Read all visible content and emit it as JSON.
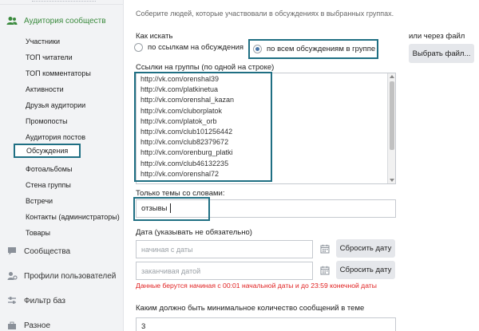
{
  "sidebar": {
    "active_section": "Аудитория сообществ",
    "items": [
      "Участники",
      "ТОП читатели",
      "ТОП комментаторы",
      "Активности",
      "Друзья аудитории",
      "Промопосты",
      "Аудитория постов",
      "Обсуждения",
      "Фотоальбомы",
      "Стена группы",
      "Встречи",
      "Контакты (администраторы)",
      "Товары"
    ],
    "selected_item": "Обсуждения",
    "sections": [
      "Сообщества",
      "Профили пользователей",
      "Фильтр баз",
      "Разное"
    ],
    "accent_color": "#3a8a3d",
    "highlight_color": "#1f6f83"
  },
  "main": {
    "hint": "Соберите людей, которые участвовали в обсуждениях в выбранных группах.",
    "how_label": "Как искать",
    "radio_option_1": "по ссылкам на обсуждения",
    "radio_option_2": "по всем обсуждениям в группе",
    "selected_radio": "по всем обсуждениям в группе",
    "file_label": "или через файл",
    "file_button": "Выбрать файл...",
    "links_label": "Ссылки на группы (по одной на строке)",
    "links": [
      "http://vk.com/orenshal39",
      "http://vk.com/platkinetua",
      "http://vk.com/orenshal_kazan",
      "http://vk.com/cluborplatok",
      "http://vk.com/platok_orb",
      "http://vk.com/club101256442",
      "http://vk.com/club82379672",
      "http://vk.com/orenburg_platki",
      "http://vk.com/club46132235",
      "http://vk.com/orenshal72"
    ],
    "keywords_label": "Только темы со словами:",
    "keywords_value": "отзывы",
    "date_label": "Дата (указывать не обязательно)",
    "date_start_placeholder": "начиная с даты",
    "date_end_placeholder": "заканчивая датой",
    "reset_button": "Сбросить дату",
    "warning": "Данные берутся начиная с 00:01 начальной даты и до 23:59 конечной даты",
    "min_label": "Каким должно быть минимальное количество сообщений в теме",
    "min_value": "3"
  }
}
